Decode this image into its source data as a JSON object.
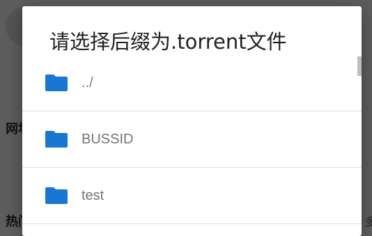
{
  "background": {
    "label_1": "网址",
    "label_2": "热门",
    "right_text": "多"
  },
  "dialog": {
    "title": "请选择后缀为.torrent文件",
    "items": [
      {
        "name": "../",
        "icon": "folder-icon"
      },
      {
        "name": "BUSSID",
        "icon": "folder-icon"
      },
      {
        "name": "test",
        "icon": "folder-icon"
      }
    ]
  },
  "colors": {
    "folder": "#1976d2",
    "overlay": "#5d5d5d",
    "title": "#212121",
    "item_text": "#757575"
  }
}
